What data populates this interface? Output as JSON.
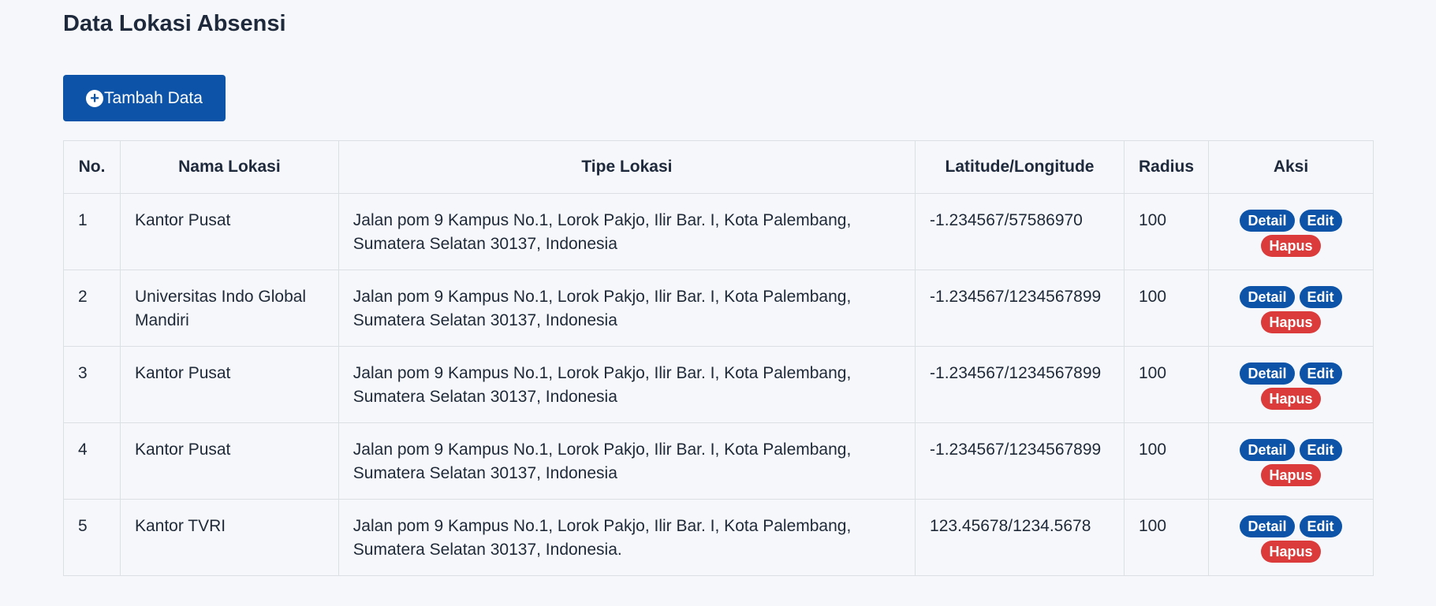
{
  "page": {
    "title": "Data Lokasi Absensi"
  },
  "toolbar": {
    "add_label": "Tambah Data",
    "add_icon": "plus-circle-icon"
  },
  "table": {
    "headers": [
      "No.",
      "Nama Lokasi",
      "Tipe Lokasi",
      "Latitude/Longitude",
      "Radius",
      "Aksi"
    ],
    "rows": [
      {
        "no": "1",
        "nama": "Kantor Pusat",
        "tipe": "Jalan pom 9 Kampus No.1, Lorok Pakjo, Ilir Bar. I, Kota Palembang, Sumatera Selatan 30137, Indonesia",
        "latlng": "-1.234567/57586970",
        "radius": "100"
      },
      {
        "no": "2",
        "nama": "Universitas Indo Global Mandiri",
        "tipe": "Jalan pom 9 Kampus No.1, Lorok Pakjo, Ilir Bar. I, Kota Palembang, Sumatera Selatan 30137, Indonesia",
        "latlng": "-1.234567/1234567899",
        "radius": "100"
      },
      {
        "no": "3",
        "nama": "Kantor Pusat",
        "tipe": "Jalan pom 9 Kampus No.1, Lorok Pakjo, Ilir Bar. I, Kota Palembang, Sumatera Selatan 30137, Indonesia",
        "latlng": "-1.234567/1234567899",
        "radius": "100"
      },
      {
        "no": "4",
        "nama": "Kantor Pusat",
        "tipe": "Jalan pom 9 Kampus No.1, Lorok Pakjo, Ilir Bar. I, Kota Palembang, Sumatera Selatan 30137, Indonesia",
        "latlng": "-1.234567/1234567899",
        "radius": "100"
      },
      {
        "no": "5",
        "nama": "Kantor TVRI",
        "tipe": "Jalan pom 9 Kampus No.1, Lorok Pakjo, Ilir Bar. I, Kota Palembang, Sumatera Selatan 30137, Indonesia.",
        "latlng": "123.45678/1234.5678",
        "radius": "100"
      }
    ],
    "actions": {
      "detail": "Detail",
      "edit": "Edit",
      "hapus": "Hapus"
    }
  },
  "colors": {
    "primary": "#0d54a8",
    "danger": "#dc3b3b",
    "background": "#f5f7fa",
    "border": "#dcdfe3"
  }
}
